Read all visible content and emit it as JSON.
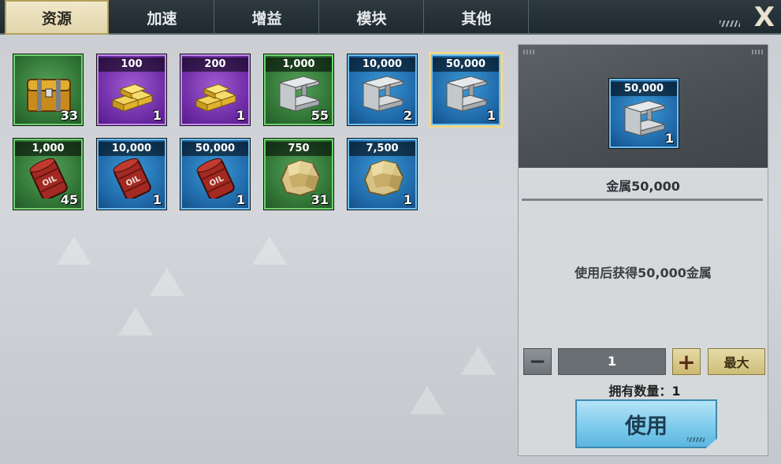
{
  "tabs": [
    {
      "label": "资源",
      "active": true
    },
    {
      "label": "加速",
      "active": false
    },
    {
      "label": "增益",
      "active": false
    },
    {
      "label": "模块",
      "active": false
    },
    {
      "label": "其他",
      "active": false
    }
  ],
  "close_label": "X",
  "items": [
    {
      "label": "",
      "count": "33",
      "rarity": "green",
      "icon": "treasure-chest-icon"
    },
    {
      "label": "100",
      "count": "1",
      "rarity": "purple",
      "icon": "gold-bars-icon"
    },
    {
      "label": "200",
      "count": "1",
      "rarity": "purple",
      "icon": "gold-bars-icon"
    },
    {
      "label": "1,000",
      "count": "55",
      "rarity": "green",
      "icon": "steel-beam-icon"
    },
    {
      "label": "10,000",
      "count": "2",
      "rarity": "blue",
      "icon": "steel-beam-icon"
    },
    {
      "label": "50,000",
      "count": "1",
      "rarity": "blue",
      "icon": "steel-beam-icon",
      "selected": true
    },
    {
      "label": "1,000",
      "count": "45",
      "rarity": "green",
      "icon": "oil-barrel-icon"
    },
    {
      "label": "10,000",
      "count": "1",
      "rarity": "blue",
      "icon": "oil-barrel-icon"
    },
    {
      "label": "50,000",
      "count": "1",
      "rarity": "blue",
      "icon": "oil-barrel-icon"
    },
    {
      "label": "750",
      "count": "31",
      "rarity": "green",
      "icon": "ore-rock-icon"
    },
    {
      "label": "7,500",
      "count": "1",
      "rarity": "blue",
      "icon": "ore-rock-icon"
    }
  ],
  "detail": {
    "icon_label": "50,000",
    "icon_count": "1",
    "icon": "steel-beam-icon",
    "name": "金属50,000",
    "description": "使用后获得50,000金属",
    "minus": "−",
    "quantity": "1",
    "plus": "+",
    "max_label": "最大",
    "owned_text": "拥有数量：1",
    "use_label": "使用"
  }
}
